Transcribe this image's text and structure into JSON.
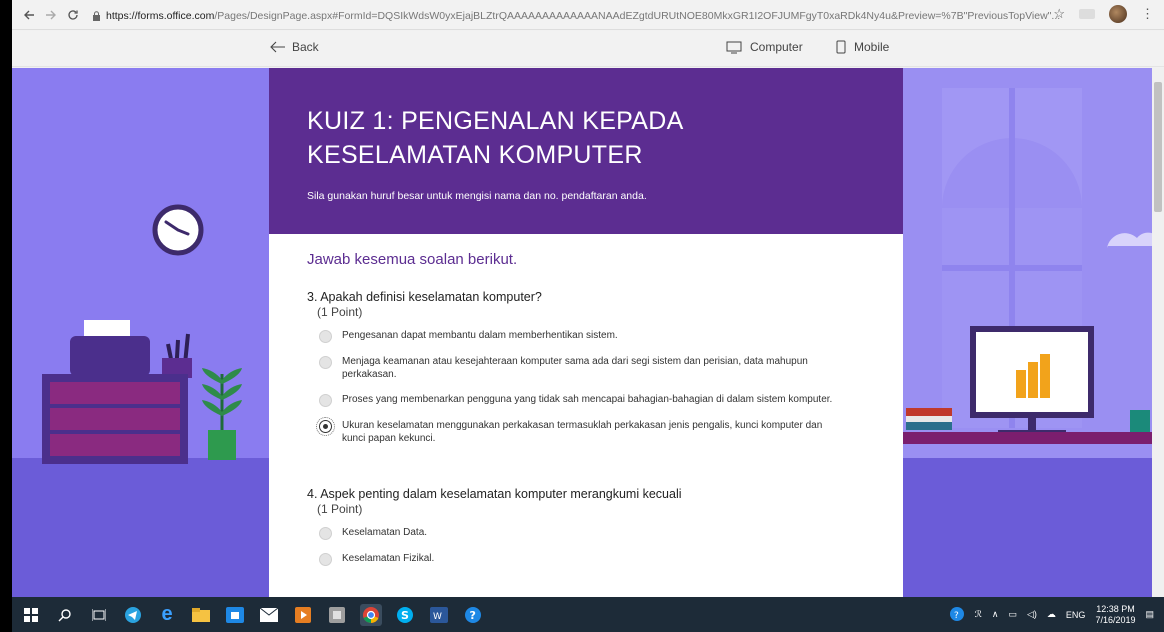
{
  "browser": {
    "back_icon": "arrow-left-icon",
    "forward_icon": "arrow-right-icon",
    "reload_icon": "reload-icon",
    "url_host": "https://forms.office.com",
    "url_path": "/Pages/DesignPage.aspx#FormId=DQSIkWdsW0yxEjajBLZtrQAAAAAAAAAAAAANAAdEZgtdURUtNOE80MkxGR1I2OFJUMFgyT0xaRDk4Ny4u&Preview=%7B\"PreviousTopView\"..."
  },
  "toolbar": {
    "back_label": "Back",
    "computer_label": "Computer",
    "mobile_label": "Mobile"
  },
  "form": {
    "title": "KUIZ 1: PENGENALAN KEPADA KESELAMATAN KOMPUTER",
    "subtitle": "Sila gunakan huruf besar untuk mengisi nama dan no. pendaftaran anda.",
    "section_title": "Jawab kesemua soalan berikut.",
    "questions": [
      {
        "title": "3. Apakah definisi keselamatan komputer?",
        "points": "(1 Point)",
        "options": [
          "Pengesanan dapat membantu dalam memberhentikan sistem.",
          "Menjaga keamanan atau kesejahteraan komputer sama ada dari segi sistem dan perisian, data mahupun perkakasan.",
          "Proses yang membenarkan pengguna yang tidak sah mencapai bahagian-bahagian di dalam sistem komputer.",
          "Ukuran keselamatan menggunakan perkakasan termasuklah perkakasan jenis pengalis, kunci komputer dan kunci papan kekunci."
        ],
        "selected_index": 3
      },
      {
        "title": "4. Aspek penting dalam keselamatan komputer merangkumi kecuali",
        "points": "(1 Point)",
        "options": [
          "Keselamatan Data.",
          "Keselamatan Fizikal."
        ]
      }
    ]
  },
  "taskbar": {
    "language": "ENG",
    "time": "12:38 PM",
    "date": "7/16/2019"
  },
  "colors": {
    "header_purple": "#5c2d91",
    "scene_purple": "#8a7cf0",
    "taskbar": "#1d2b38"
  }
}
